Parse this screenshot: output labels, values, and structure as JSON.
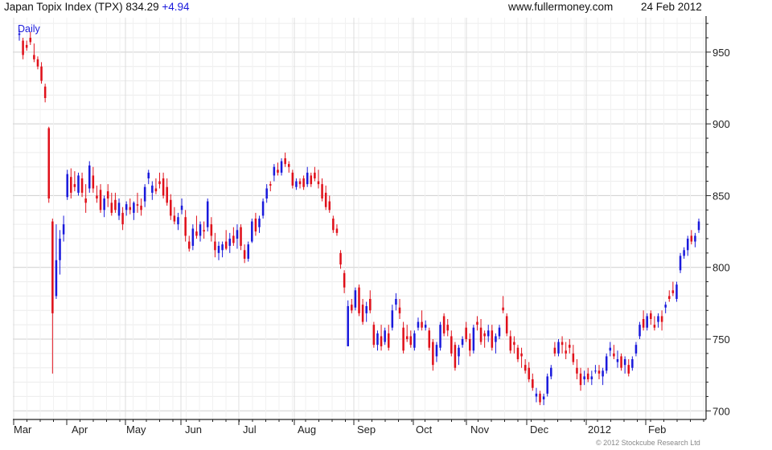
{
  "header": {
    "title": "Japan Topix Index (TPX)",
    "last": "834.29",
    "change": "+4.94",
    "site": "www.fullermoney.com",
    "date": "24 Feb 2012"
  },
  "copyright": "© 2012 Stockcube Research Ltd",
  "colors": {
    "up": "#1a1adc",
    "down": "#e0101a",
    "grid": "#d8d8d8",
    "axis": "#222222"
  },
  "chart_data": {
    "type": "candlestick",
    "period_label": "Daily",
    "x_tick_labels": [
      "Mar",
      "Apr",
      "May",
      "Jun",
      "Jul",
      "Aug",
      "Sep",
      "Oct",
      "Nov",
      "Dec",
      "2012",
      "Feb"
    ],
    "y_tick_labels": [
      950,
      900,
      850,
      800,
      750,
      700
    ],
    "ylim": [
      694,
      974
    ],
    "grid": true,
    "series": [
      {
        "values": [
          [
            962,
            966,
            958,
            963
          ],
          [
            958,
            960,
            945,
            948
          ],
          [
            955,
            958,
            951,
            953
          ],
          [
            960,
            964,
            955,
            957
          ],
          [
            948,
            956,
            943,
            945
          ],
          [
            945,
            947,
            938,
            940
          ],
          [
            940,
            943,
            928,
            930
          ],
          [
            926,
            928,
            915,
            918
          ],
          [
            897,
            898,
            845,
            848
          ],
          [
            832,
            834,
            726,
            768
          ],
          [
            780,
            830,
            778,
            805
          ],
          [
            805,
            826,
            795,
            820
          ],
          [
            823,
            836,
            818,
            830
          ],
          [
            849,
            868,
            847,
            865
          ],
          [
            863,
            869,
            848,
            852
          ],
          [
            858,
            867,
            853,
            856
          ],
          [
            852,
            866,
            850,
            864
          ],
          [
            862,
            866,
            849,
            852
          ],
          [
            848,
            858,
            838,
            845
          ],
          [
            855,
            874,
            852,
            871
          ],
          [
            864,
            870,
            852,
            855
          ],
          [
            850,
            857,
            845,
            848
          ],
          [
            854,
            858,
            838,
            840
          ],
          [
            840,
            850,
            835,
            848
          ],
          [
            853,
            858,
            842,
            848
          ],
          [
            845,
            852,
            836,
            838
          ],
          [
            847,
            852,
            838,
            840
          ],
          [
            836,
            848,
            833,
            845
          ],
          [
            838,
            842,
            826,
            830
          ],
          [
            840,
            846,
            836,
            844
          ],
          [
            842,
            848,
            837,
            840
          ],
          [
            838,
            846,
            833,
            845
          ],
          [
            844,
            852,
            838,
            843
          ],
          [
            843,
            848,
            836,
            840
          ],
          [
            846,
            858,
            842,
            856
          ],
          [
            862,
            868,
            858,
            866
          ],
          [
            852,
            860,
            847,
            857
          ],
          [
            855,
            862,
            851,
            853
          ],
          [
            860,
            866,
            855,
            858
          ],
          [
            862,
            866,
            848,
            850
          ],
          [
            856,
            862,
            843,
            845
          ],
          [
            847,
            851,
            833,
            836
          ],
          [
            836,
            842,
            830,
            832
          ],
          [
            830,
            838,
            826,
            835
          ],
          [
            840,
            848,
            837,
            843
          ],
          [
            835,
            840,
            818,
            822
          ],
          [
            818,
            822,
            811,
            813
          ],
          [
            815,
            830,
            812,
            827
          ],
          [
            825,
            836,
            820,
            822
          ],
          [
            822,
            832,
            818,
            830
          ],
          [
            826,
            832,
            820,
            825
          ],
          [
            828,
            848,
            825,
            846
          ],
          [
            830,
            835,
            818,
            822
          ],
          [
            818,
            824,
            807,
            812
          ],
          [
            810,
            818,
            805,
            815
          ],
          [
            812,
            818,
            807,
            816
          ],
          [
            818,
            826,
            812,
            813
          ],
          [
            815,
            824,
            810,
            820
          ],
          [
            822,
            828,
            815,
            817
          ],
          [
            820,
            830,
            813,
            826
          ],
          [
            828,
            830,
            812,
            815
          ],
          [
            812,
            816,
            803,
            806
          ],
          [
            806,
            818,
            804,
            816
          ],
          [
            818,
            834,
            817,
            832
          ],
          [
            834,
            838,
            822,
            825
          ],
          [
            828,
            836,
            824,
            834
          ],
          [
            836,
            848,
            834,
            846
          ],
          [
            848,
            858,
            845,
            855
          ],
          [
            858,
            860,
            853,
            857
          ],
          [
            864,
            872,
            860,
            870
          ],
          [
            868,
            873,
            864,
            866
          ],
          [
            866,
            876,
            864,
            874
          ],
          [
            876,
            880,
            870,
            872
          ],
          [
            872,
            874,
            866,
            870
          ],
          [
            866,
            868,
            855,
            857
          ],
          [
            856,
            862,
            854,
            860
          ],
          [
            860,
            862,
            855,
            858
          ],
          [
            862,
            864,
            854,
            856
          ],
          [
            858,
            870,
            856,
            866
          ],
          [
            864,
            866,
            856,
            858
          ],
          [
            866,
            870,
            860,
            862
          ],
          [
            860,
            868,
            855,
            858
          ],
          [
            858,
            862,
            846,
            848
          ],
          [
            852,
            857,
            840,
            842
          ],
          [
            846,
            850,
            838,
            840
          ],
          [
            834,
            836,
            824,
            826
          ],
          [
            827,
            830,
            822,
            824
          ],
          [
            810,
            812,
            799,
            802
          ],
          [
            796,
            798,
            782,
            786
          ],
          [
            745,
            777,
            745,
            773
          ],
          [
            774,
            778,
            768,
            770
          ],
          [
            772,
            786,
            770,
            784
          ],
          [
            786,
            788,
            766,
            768
          ],
          [
            774,
            778,
            760,
            762
          ],
          [
            768,
            776,
            762,
            773
          ],
          [
            778,
            784,
            768,
            770
          ],
          [
            760,
            762,
            744,
            746
          ],
          [
            746,
            756,
            742,
            754
          ],
          [
            752,
            760,
            742,
            745
          ],
          [
            748,
            758,
            746,
            756
          ],
          [
            754,
            760,
            742,
            744
          ],
          [
            758,
            774,
            756,
            770
          ],
          [
            774,
            782,
            770,
            778
          ],
          [
            772,
            778,
            764,
            768
          ],
          [
            758,
            762,
            740,
            742
          ],
          [
            752,
            760,
            748,
            750
          ],
          [
            752,
            756,
            744,
            746
          ],
          [
            744,
            756,
            742,
            754
          ],
          [
            758,
            765,
            756,
            762
          ],
          [
            762,
            770,
            756,
            758
          ],
          [
            758,
            763,
            756,
            760
          ],
          [
            756,
            758,
            742,
            744
          ],
          [
            748,
            750,
            728,
            732
          ],
          [
            738,
            748,
            734,
            746
          ],
          [
            744,
            762,
            742,
            760
          ],
          [
            766,
            768,
            752,
            754
          ],
          [
            760,
            764,
            752,
            756
          ],
          [
            752,
            756,
            738,
            740
          ],
          [
            746,
            748,
            728,
            730
          ],
          [
            738,
            746,
            732,
            744
          ],
          [
            746,
            752,
            744,
            750
          ],
          [
            758,
            762,
            748,
            750
          ],
          [
            750,
            754,
            738,
            742
          ],
          [
            742,
            760,
            740,
            758
          ],
          [
            762,
            766,
            756,
            760
          ],
          [
            758,
            764,
            746,
            748
          ],
          [
            754,
            756,
            744,
            752
          ],
          [
            752,
            760,
            748,
            756
          ],
          [
            756,
            760,
            742,
            744
          ],
          [
            748,
            754,
            740,
            752
          ],
          [
            752,
            760,
            750,
            758
          ],
          [
            772,
            780,
            768,
            770
          ],
          [
            766,
            768,
            752,
            754
          ],
          [
            752,
            756,
            740,
            742
          ],
          [
            748,
            752,
            740,
            746
          ],
          [
            744,
            746,
            734,
            736
          ],
          [
            740,
            744,
            730,
            738
          ],
          [
            732,
            736,
            726,
            728
          ],
          [
            730,
            734,
            720,
            722
          ],
          [
            722,
            726,
            714,
            716
          ],
          [
            710,
            716,
            706,
            712
          ],
          [
            712,
            714,
            704,
            706
          ],
          [
            708,
            712,
            704,
            710
          ],
          [
            712,
            726,
            710,
            724
          ],
          [
            724,
            732,
            722,
            730
          ],
          [
            744,
            748,
            738,
            740
          ],
          [
            740,
            750,
            738,
            748
          ],
          [
            748,
            752,
            740,
            746
          ],
          [
            742,
            748,
            736,
            740
          ],
          [
            746,
            750,
            740,
            744
          ],
          [
            740,
            746,
            732,
            734
          ],
          [
            730,
            736,
            722,
            726
          ],
          [
            726,
            730,
            714,
            718
          ],
          [
            722,
            728,
            718,
            724
          ],
          [
            726,
            730,
            720,
            722
          ],
          [
            722,
            728,
            718,
            724
          ],
          [
            728,
            732,
            726,
            728
          ],
          [
            728,
            732,
            722,
            726
          ],
          [
            724,
            730,
            718,
            728
          ],
          [
            728,
            740,
            726,
            738
          ],
          [
            742,
            748,
            738,
            744
          ],
          [
            740,
            746,
            736,
            738
          ],
          [
            734,
            742,
            730,
            736
          ],
          [
            738,
            740,
            728,
            730
          ],
          [
            732,
            738,
            726,
            736
          ],
          [
            732,
            736,
            724,
            726
          ],
          [
            730,
            738,
            728,
            736
          ],
          [
            740,
            748,
            738,
            746
          ],
          [
            752,
            762,
            750,
            760
          ],
          [
            764,
            770,
            756,
            758
          ],
          [
            758,
            768,
            756,
            766
          ],
          [
            768,
            770,
            760,
            764
          ],
          [
            760,
            766,
            756,
            758
          ],
          [
            762,
            768,
            758,
            766
          ],
          [
            766,
            770,
            756,
            762
          ],
          [
            772,
            776,
            768,
            774
          ],
          [
            780,
            784,
            776,
            778
          ],
          [
            784,
            790,
            780,
            782
          ],
          [
            778,
            790,
            776,
            788
          ],
          [
            798,
            810,
            796,
            808
          ],
          [
            808,
            814,
            806,
            812
          ],
          [
            812,
            822,
            808,
            820
          ],
          [
            822,
            826,
            816,
            818
          ],
          [
            818,
            824,
            814,
            822
          ],
          [
            826,
            834,
            824,
            832
          ]
        ]
      }
    ]
  }
}
